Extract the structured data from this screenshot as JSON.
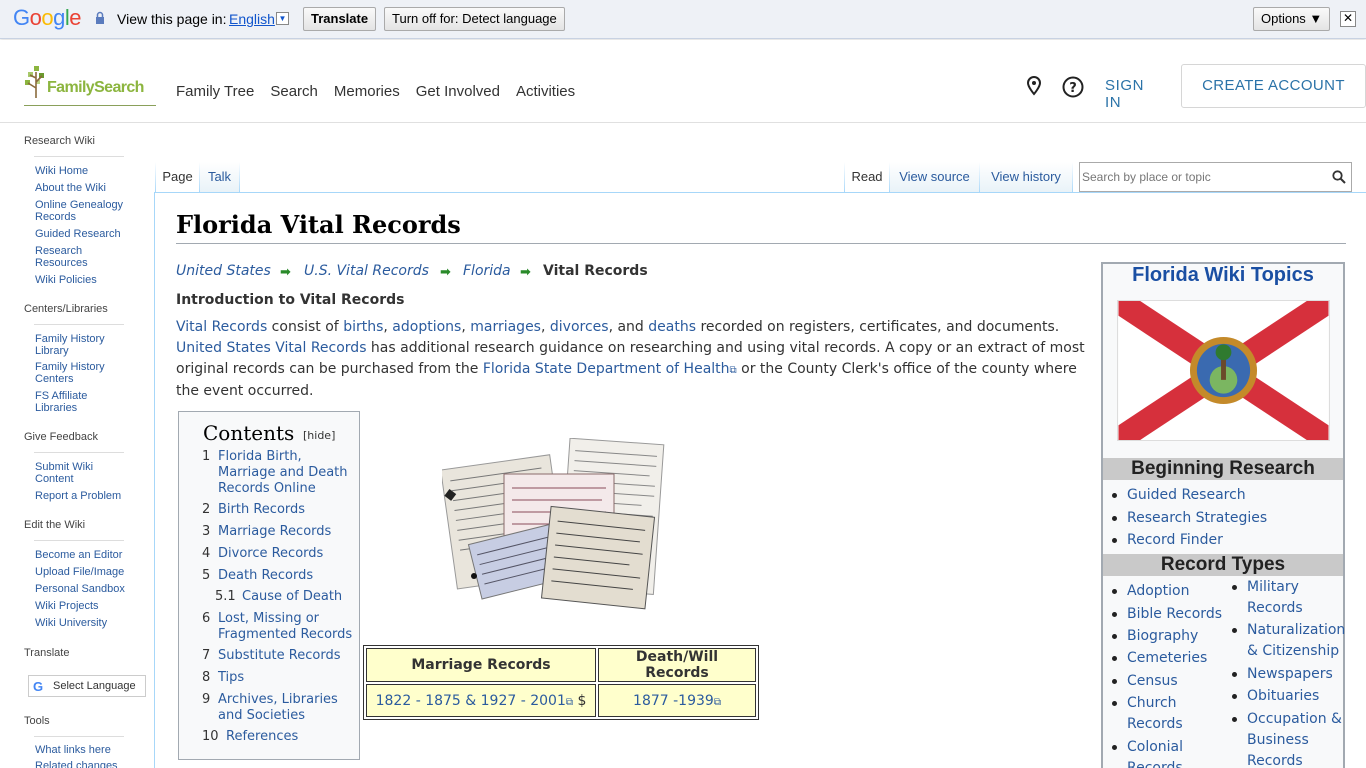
{
  "translate_bar": {
    "google_logo": "Google",
    "view_text": "View this page in:",
    "language": "English",
    "translate_btn": "Translate",
    "turnoff_btn": "Turn off for: Detect language",
    "options_btn": "Options ▼",
    "close": "✕"
  },
  "header": {
    "logo_text": "FamilySearch",
    "nav": [
      "Family Tree",
      "Search",
      "Memories",
      "Get Involved",
      "Activities"
    ],
    "sign_in": "SIGN IN",
    "create_account": "CREATE ACCOUNT"
  },
  "sidebar": {
    "research_wiki": "Research Wiki",
    "wiki_items": [
      "Wiki Home",
      "About the Wiki",
      "Online Genealogy Records",
      "Guided Research",
      "Research Resources",
      "Wiki Policies"
    ],
    "centers_head": "Centers/Libraries",
    "centers_items": [
      "Family History Library",
      "Family History Centers",
      "FS Affiliate Libraries"
    ],
    "feedback_head": "Give Feedback",
    "feedback_items": [
      "Submit Wiki Content",
      "Report a Problem"
    ],
    "edit_head": "Edit the Wiki",
    "edit_items": [
      "Become an Editor",
      "Upload File/Image",
      "Personal Sandbox",
      "Wiki Projects",
      "Wiki University"
    ],
    "translate_head": "Translate",
    "select_language": "Select Language",
    "tools_head": "Tools",
    "tools_items": [
      "What links here",
      "Related changes"
    ]
  },
  "tabs": {
    "page": "Page",
    "talk": "Talk",
    "read": "Read",
    "view_source": "View source",
    "view_history": "View history"
  },
  "search": {
    "placeholder": "Search by place or topic"
  },
  "content": {
    "title": "Florida Vital Records",
    "breadcrumb": [
      "United States",
      "U.S. Vital Records",
      "Florida"
    ],
    "breadcrumb_current": "Vital Records",
    "intro_heading": "Introduction to Vital Records",
    "intro": {
      "vital_records": "Vital Records",
      "consist_of": " consist of ",
      "births": "births",
      "adoptions": "adoptions",
      "marriages": "marriages",
      "divorces": "divorces",
      "and": ", and ",
      "deaths": "deaths",
      "recorded": " recorded on registers, certificates, and documents.",
      "us_vital": "United States Vital Records",
      "has_additional": " has additional research guidance on researching and using vital records. A copy or an extract of most original records can be purchased from the ",
      "fl_dept": "Florida State Department of Health",
      "or_county": " or the County Clerk's office of the county where the event occurred."
    }
  },
  "toc": {
    "title": "Contents",
    "hide": "[hide]",
    "items": [
      {
        "num": "1",
        "label": "Florida Birth, Marriage and Death Records Online"
      },
      {
        "num": "2",
        "label": "Birth Records"
      },
      {
        "num": "3",
        "label": "Marriage Records"
      },
      {
        "num": "4",
        "label": "Divorce Records"
      },
      {
        "num": "5",
        "label": "Death Records"
      },
      {
        "num": "5.1",
        "label": "Cause of Death"
      },
      {
        "num": "6",
        "label": "Lost, Missing or Fragmented Records"
      },
      {
        "num": "7",
        "label": "Substitute Records"
      },
      {
        "num": "8",
        "label": "Tips"
      },
      {
        "num": "9",
        "label": "Archives, Libraries and Societies"
      },
      {
        "num": "10",
        "label": "References"
      }
    ]
  },
  "records_table": {
    "headers": [
      "Marriage Records",
      "Death/Will Records"
    ],
    "marriage_link": "1822 - 1875 & 1927 - 2001",
    "dollar": "$",
    "death_link": "1877 -1939"
  },
  "infobox": {
    "title": "Florida Wiki Topics",
    "beginning": "Beginning Research",
    "beginning_items": [
      "Guided Research",
      "Research Strategies",
      "Record Finder"
    ],
    "record_types": "Record Types",
    "left_items": [
      "Adoption",
      "Bible Records",
      "Biography",
      "Cemeteries",
      "Census",
      "Church Records",
      "Colonial Records"
    ],
    "right_items": [
      "Military Records",
      "Naturalization & Citizenship",
      "Newspapers",
      "Obituaries",
      "Occupation & Business Records"
    ]
  },
  "colors": {
    "link": "#2b5b9e",
    "brand_green": "#8cb53f",
    "flag_red": "#d6303c",
    "table_fill": "#ffffcc"
  }
}
